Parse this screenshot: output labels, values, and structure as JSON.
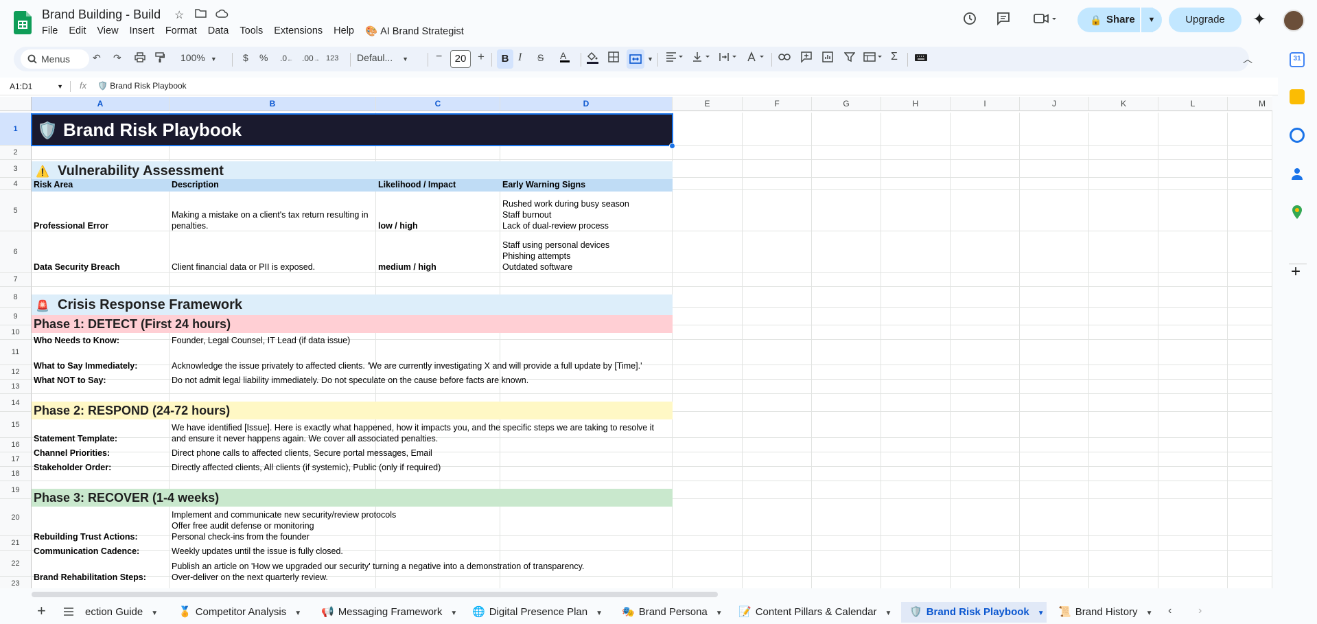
{
  "app": {
    "doc_title": "Brand Building - Build",
    "menus": [
      "File",
      "Edit",
      "View",
      "Insert",
      "Format",
      "Data",
      "Tools",
      "Extensions",
      "Help"
    ],
    "ai_menu": "AI Brand Strategist",
    "share_label": "Share",
    "upgrade_label": "Upgrade"
  },
  "toolbar": {
    "search_placeholder": "Menus",
    "zoom": "100%",
    "currency": "$",
    "percent": "%",
    "dec_decrease": ".0",
    "dec_increase": ".00",
    "number_format": "123",
    "font": "Defaul...",
    "font_size": "20",
    "bold": "B",
    "italic": "I",
    "strike": "S",
    "text_color": "A"
  },
  "formula": {
    "name_box": "A1:D1",
    "fx": "fx",
    "content": "🛡️ Brand Risk Playbook"
  },
  "columns": [
    "A",
    "B",
    "C",
    "D",
    "E",
    "F",
    "G",
    "H",
    "I",
    "J",
    "K",
    "L",
    "M"
  ],
  "rows": [
    "1",
    "2",
    "3",
    "4",
    "5",
    "6",
    "7",
    "8",
    "9",
    "10",
    "11",
    "12",
    "13",
    "14",
    "15",
    "16",
    "17",
    "18",
    "19",
    "20",
    "21",
    "22",
    "23"
  ],
  "sheet": {
    "title": "Brand Risk Playbook",
    "title_icon": "🛡️",
    "vuln_icon": "⚠️",
    "vuln_heading": "Vulnerability Assessment",
    "headers": [
      "Risk Area",
      "Description",
      "Likelihood / Impact",
      "Early Warning Signs"
    ],
    "risk_rows": [
      {
        "area": "Professional Error",
        "description": "Making a mistake on a client's tax return resulting in penalties.",
        "impact": "low / high",
        "signs": [
          "Rushed work during busy season",
          "Staff burnout",
          "Lack of dual-review process"
        ]
      },
      {
        "area": "Data Security Breach",
        "description": "Client financial data or PII is exposed.",
        "impact": "medium / high",
        "signs": [
          "Staff using personal devices",
          "Phishing attempts",
          "Outdated software"
        ]
      }
    ],
    "crisis_icon": "🚨",
    "crisis_heading": "Crisis Response Framework",
    "phase1": "Phase 1: DETECT (First 24 hours)",
    "p1_rows": [
      {
        "label": "Who Needs to Know:",
        "value": "Founder, Legal Counsel, IT Lead (if data issue)"
      },
      {
        "label": "What to Say Immediately:",
        "value": "Acknowledge the issue privately to affected clients. 'We are currently investigating X and will provide a full update by [Time].'"
      },
      {
        "label": "What NOT to Say:",
        "value": "Do not admit legal liability immediately. Do not speculate on the cause before facts are known."
      }
    ],
    "phase2": "Phase 2: RESPOND (24-72 hours)",
    "p2_rows": [
      {
        "label": "Statement Template:",
        "value": "We have identified [Issue]. Here is exactly what happened, how it impacts you, and the specific steps we are taking to resolve it and ensure it never happens again. We cover all associated penalties."
      },
      {
        "label": "Channel Priorities:",
        "value": "Direct phone calls to affected clients, Secure portal messages, Email"
      },
      {
        "label": "Stakeholder Order:",
        "value": "Directly affected clients, All clients (if systemic), Public (only if required)"
      }
    ],
    "phase3": "Phase 3: RECOVER (1-4 weeks)",
    "p3_rows": [
      {
        "label": "Rebuilding Trust Actions:",
        "lines": [
          "Implement and communicate new security/review protocols",
          "Offer free audit defense or monitoring",
          "Personal check-ins from the founder"
        ]
      },
      {
        "label": "Communication Cadence:",
        "lines": [
          "Weekly updates until the issue is fully closed."
        ]
      },
      {
        "label": "Brand Rehabilitation Steps:",
        "lines": [
          "Publish an article on 'How we upgraded our security' turning a negative into a demonstration of transparency.",
          "Over-deliver on the next quarterly review."
        ]
      }
    ]
  },
  "tabs": [
    {
      "label": "ection Guide",
      "icon": ""
    },
    {
      "label": "Competitor Analysis",
      "icon": "🏅"
    },
    {
      "label": "Messaging Framework",
      "icon": "📢"
    },
    {
      "label": "Digital Presence Plan",
      "icon": "🌐"
    },
    {
      "label": "Brand Persona",
      "icon": "🎭"
    },
    {
      "label": "Content Pillars & Calendar",
      "icon": "📝"
    },
    {
      "label": "Brand Risk Playbook",
      "icon": "🛡️"
    },
    {
      "label": "Brand History",
      "icon": "📜"
    }
  ],
  "colors": {
    "title_bg": "#1a1a2e",
    "section_bg": "#ddeefa",
    "header_bg": "#bfdcf5",
    "phase1_bg": "#ffcfd4",
    "phase2_bg": "#fff8c5",
    "phase3_bg": "#c9e8cd",
    "accent": "#0b57d0"
  }
}
